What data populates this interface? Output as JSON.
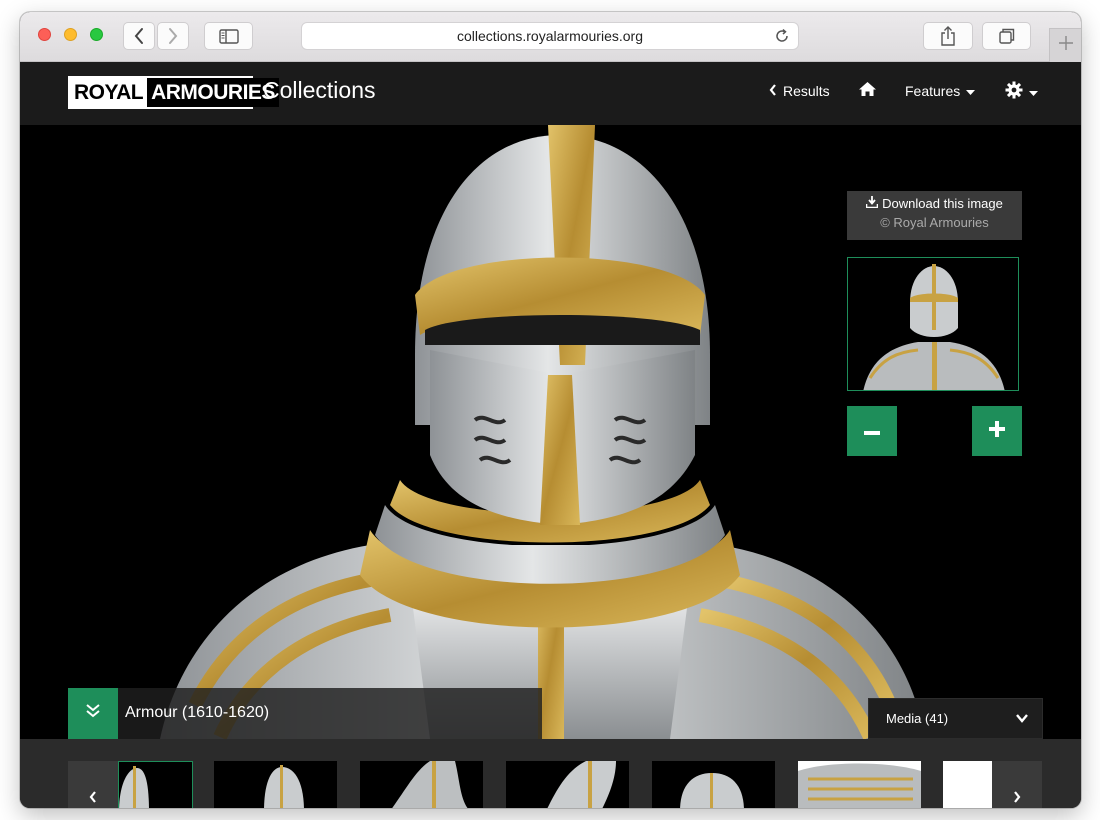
{
  "browser": {
    "url": "collections.royalarmouries.org",
    "icons": [
      "back-icon",
      "forward-icon",
      "sidebar-icon",
      "reload-icon",
      "share-icon",
      "tabs-icon",
      "new-tab-icon"
    ]
  },
  "header": {
    "logo_part1": "ROYAL",
    "logo_part2": "ARMOURIES",
    "site_name": "Collections",
    "nav": {
      "results": "Results",
      "features": "Features"
    }
  },
  "viewer": {
    "download_label": "Download this image",
    "copyright": "© Royal Armouries",
    "object_title": "Armour (1610-1620)",
    "media_label": "Media (41)"
  },
  "colors": {
    "accent_green": "#1e8e5a",
    "header_bg": "#1b1b1b",
    "gold": "#c8a243",
    "steel": "#c9ccce"
  }
}
